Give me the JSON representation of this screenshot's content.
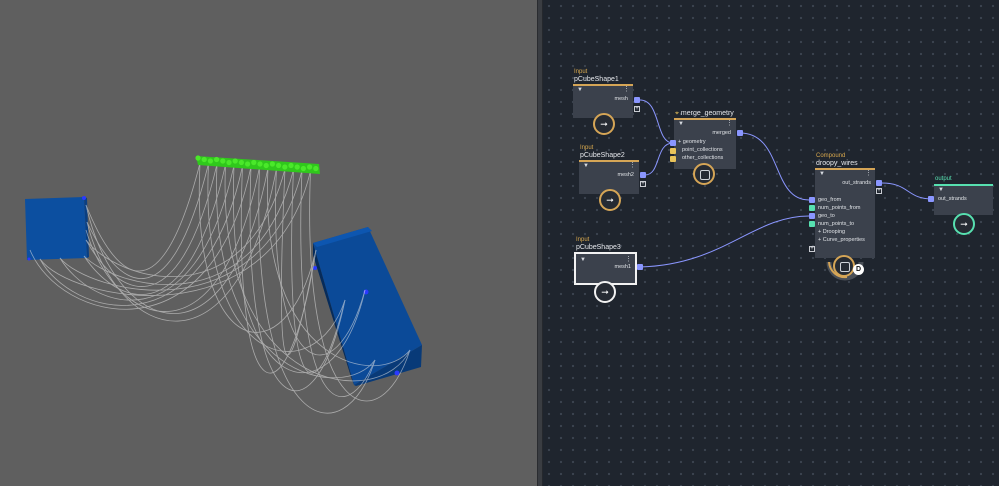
{
  "viewport": {
    "background": "#5f5f5f",
    "cube_color": "#0c4fa0",
    "curve_color": "#e6e6e6",
    "source_color": "#34d41c"
  },
  "graph": {
    "background": "#1f252e",
    "wire_color": "#8a96ff",
    "nodes": {
      "input1": {
        "category": "Input",
        "title": "pCubeShape1",
        "out_port": "mesh",
        "icon": "arrow-icon"
      },
      "input2": {
        "category": "Input",
        "title": "pCubeShape2",
        "out_port": "mesh2",
        "icon": "arrow-icon"
      },
      "input3": {
        "category": "Input",
        "title": "pCubeShape3",
        "out_port": "mesh1",
        "icon": "arrow-icon"
      },
      "merge": {
        "title": "merge_geometry",
        "in_ports": [
          "geometry",
          "point_collections",
          "other_collections"
        ],
        "out_port": "merged",
        "icon": "cube-icon"
      },
      "compound": {
        "category": "Compound",
        "title": "droopy_wires",
        "out_port": "out_strands",
        "in_ports": [
          "geo_from",
          "num_points_from",
          "geo_to",
          "num_points_to"
        ],
        "groups": [
          "Drooping",
          "Curve_properties"
        ],
        "badge": "D",
        "icon": "cube-icon"
      },
      "output": {
        "category": "output",
        "title": "out_strands",
        "icon": "arrow-icon"
      }
    }
  }
}
